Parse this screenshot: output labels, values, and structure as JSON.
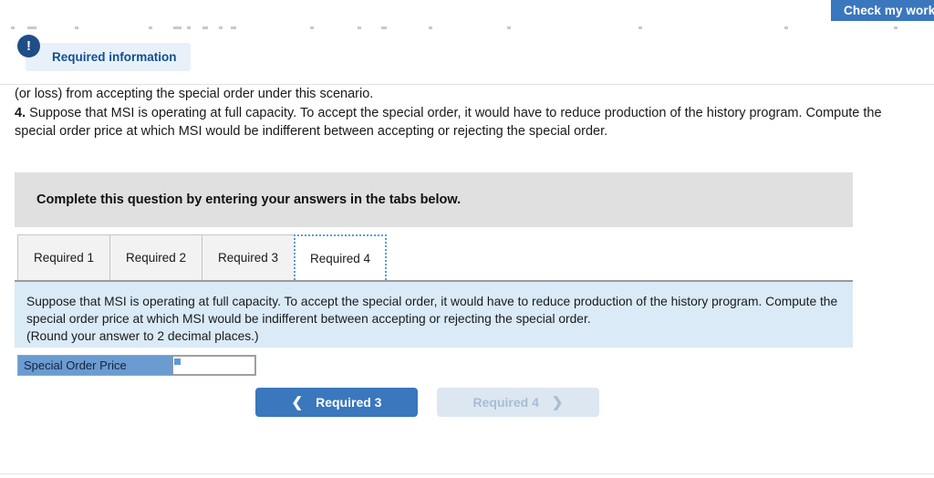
{
  "toolbar": {
    "check_my_work_label": "Check my work"
  },
  "required_info": {
    "icon": "exclamation-icon",
    "label": "Required information"
  },
  "question": {
    "continued_line": "(or loss) from accepting the special order under this scenario.",
    "number": "4.",
    "text": "Suppose that MSI is operating at full capacity. To accept the special order, it would have to reduce production of the history program. Compute the special order price at which MSI would be indifferent between accepting or rejecting the special order."
  },
  "instruction": {
    "text": "Complete this question by entering your answers in the tabs below."
  },
  "tabs": [
    {
      "label": "Required 1",
      "active": false
    },
    {
      "label": "Required 2",
      "active": false
    },
    {
      "label": "Required 3",
      "active": false
    },
    {
      "label": "Required 4",
      "active": true
    }
  ],
  "panel": {
    "body": "Suppose that MSI is operating at full capacity. To accept the special order, it would have to reduce production of the history program. Compute the special order price at which MSI would be indifferent between accepting or rejecting the special order.",
    "round_note": "(Round your answer to 2 decimal places.)"
  },
  "answer": {
    "label": "Special Order Price",
    "value": "",
    "placeholder": ""
  },
  "navigation": {
    "prev_label": "Required 3",
    "prev_icon": "chevron-left-icon",
    "next_label": "Required 4",
    "next_icon": "chevron-right-icon"
  },
  "colors": {
    "primary_blue": "#3a77bd",
    "panel_blue": "#daeaf7",
    "label_blue": "#6a9bd1",
    "badge_navy": "#1f4e87",
    "instruction_grey": "#e0e0e0",
    "warning_red": "#c00000"
  }
}
